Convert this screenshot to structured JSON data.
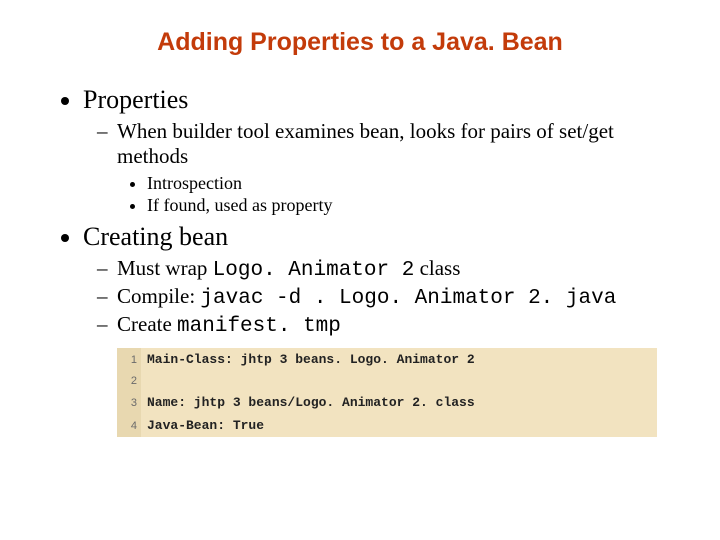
{
  "title": "Adding Properties to a Java. Bean",
  "bullets": {
    "b1": "Properties",
    "b1_1": "When builder tool examines bean, looks for pairs of set/get methods",
    "b1_1_1": "Introspection",
    "b1_1_2": "If found, used as property",
    "b2": "Creating bean",
    "b2_1_pre": "Must wrap ",
    "b2_1_code": "Logo. Animator 2",
    "b2_1_post": " class",
    "b2_2_pre": "Compile: ",
    "b2_2_code": "javac -d . Logo. Animator 2. java",
    "b2_3_pre": "Create ",
    "b2_3_code": "manifest. tmp"
  },
  "code": {
    "l1n": "1",
    "l1": "Main-Class: jhtp 3 beans. Logo. Animator 2",
    "l2n": "2",
    "l2": "",
    "l3n": "3",
    "l3": "Name: jhtp 3 beans/Logo. Animator 2. class",
    "l4n": "4",
    "l4": "Java-Bean: True"
  }
}
